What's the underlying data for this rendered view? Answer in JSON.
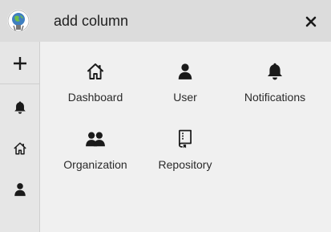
{
  "header": {
    "title": "add column",
    "close_icon": "close-icon",
    "avatar_icon": "avatar-globe-icon"
  },
  "sidebar": {
    "items": [
      {
        "icon": "plus-icon"
      },
      {
        "icon": "bell-icon"
      },
      {
        "icon": "home-icon"
      },
      {
        "icon": "user-icon"
      }
    ]
  },
  "columns": [
    {
      "label": "Dashboard",
      "icon": "home-icon"
    },
    {
      "label": "User",
      "icon": "user-icon"
    },
    {
      "label": "Notifications",
      "icon": "bell-icon"
    },
    {
      "label": "Organization",
      "icon": "organization-icon"
    },
    {
      "label": "Repository",
      "icon": "repository-icon"
    }
  ],
  "colors": {
    "header_bg": "#dcdcdc",
    "sidebar_bg": "#e6e6e6",
    "content_bg": "#f0f0f0",
    "icon": "#1a1a1a"
  }
}
